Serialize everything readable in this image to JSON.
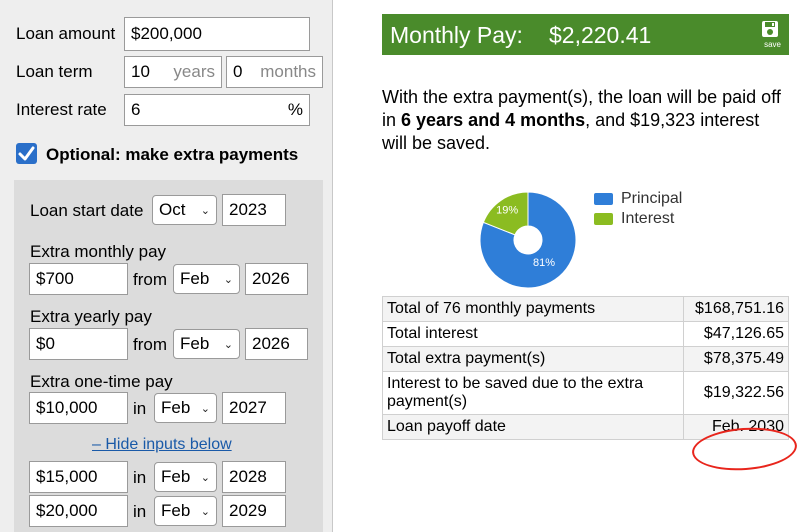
{
  "colors": {
    "header_bg": "#4a8b2b",
    "principal": "#2f7ed8",
    "interest": "#8bbc21",
    "circle": "#e8251c"
  },
  "form": {
    "loan_amount": {
      "label": "Loan amount",
      "value": "$200,000"
    },
    "loan_term": {
      "label": "Loan term",
      "years_value": "10",
      "years_unit": "years",
      "months_value": "0",
      "months_unit": "months"
    },
    "interest_rate": {
      "label": "Interest rate",
      "value": "6",
      "unit": "%"
    },
    "optional_label": "Optional: make extra payments",
    "start_date": {
      "label": "Loan start date",
      "month": "Oct",
      "year": "2023"
    },
    "extra_monthly": {
      "label": "Extra monthly pay",
      "amount": "$700",
      "connector": "from",
      "month": "Feb",
      "year": "2026"
    },
    "extra_yearly": {
      "label": "Extra yearly pay",
      "amount": "$0",
      "connector": "from",
      "month": "Feb",
      "year": "2026"
    },
    "extra_onetime": {
      "label": "Extra one-time pay",
      "amount": "$10,000",
      "connector": "in",
      "month": "Feb",
      "year": "2027"
    },
    "hide_link": "– Hide inputs below",
    "extra_rows": [
      {
        "amount": "$15,000",
        "connector": "in",
        "month": "Feb",
        "year": "2028"
      },
      {
        "amount": "$20,000",
        "connector": "in",
        "month": "Feb",
        "year": "2029"
      }
    ]
  },
  "result": {
    "header_label": "Monthly Pay:",
    "header_value": "$2,220.41",
    "save_label": "save",
    "summary_pre": "With the extra payment(s), the loan will be paid off in ",
    "summary_bold": "6 years and 4 months",
    "summary_post": ", and $19,323 interest will be saved.",
    "table": [
      {
        "label": "Total of 76 monthly payments",
        "value": "$168,751.16"
      },
      {
        "label": "Total interest",
        "value": "$47,126.65"
      },
      {
        "label": "Total extra payment(s)",
        "value": "$78,375.49"
      },
      {
        "label": "Interest to be saved due to the extra payment(s)",
        "value": "$19,322.56"
      },
      {
        "label": "Loan payoff date",
        "value": "Feb. 2030"
      }
    ]
  },
  "chart_data": {
    "type": "pie",
    "categories": [
      "Principal",
      "Interest"
    ],
    "values": [
      81,
      19
    ],
    "labels": [
      "81%",
      "19%"
    ],
    "legend": [
      "Principal",
      "Interest"
    ],
    "legend_position": "right"
  }
}
